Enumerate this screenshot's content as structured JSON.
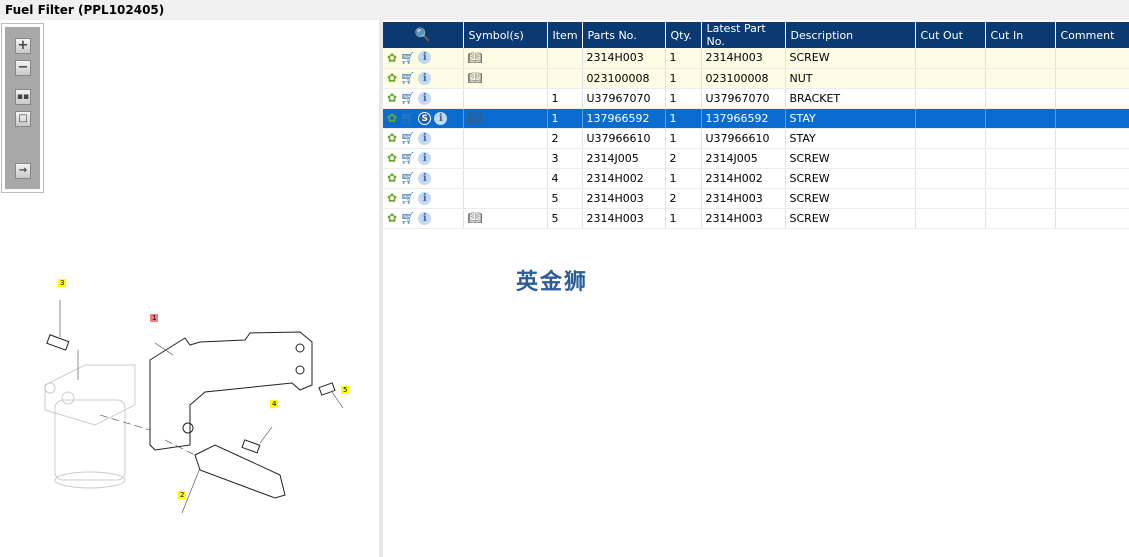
{
  "window": {
    "title": "Fuel Filter (PPL102405)"
  },
  "toolbar": {
    "buttons": [
      "zoom-in",
      "zoom-out",
      "fit-all",
      "actual-size",
      "export"
    ]
  },
  "diagram": {
    "callouts": [
      {
        "label": "1",
        "highlighted": true
      },
      {
        "label": "2"
      },
      {
        "label": "3"
      },
      {
        "label": "4"
      },
      {
        "label": "5"
      }
    ]
  },
  "grid": {
    "columns": [
      "",
      "Symbol(s)",
      "Item",
      "Parts No.",
      "Qty.",
      "Latest Part No.",
      "Description",
      "Cut Out",
      "Cut In",
      "Comment"
    ],
    "rows": [
      {
        "style": "yel",
        "symbol": true,
        "s": false,
        "item": "",
        "part": "2314H003",
        "qty": "1",
        "latest": "2314H003",
        "desc": "SCREW"
      },
      {
        "style": "yel",
        "symbol": true,
        "s": false,
        "item": "",
        "part": "023100008",
        "qty": "1",
        "latest": "023100008",
        "desc": "NUT"
      },
      {
        "style": "",
        "symbol": false,
        "s": false,
        "item": "1",
        "part": "U37967070",
        "qty": "1",
        "latest": "U37967070",
        "desc": "BRACKET"
      },
      {
        "style": "sel",
        "symbol": true,
        "s": true,
        "item": "1",
        "part": "137966592",
        "qty": "1",
        "latest": "137966592",
        "desc": "STAY"
      },
      {
        "style": "",
        "symbol": false,
        "s": false,
        "item": "2",
        "part": "U37966610",
        "qty": "1",
        "latest": "U37966610",
        "desc": "STAY"
      },
      {
        "style": "",
        "symbol": false,
        "s": false,
        "item": "3",
        "part": "2314J005",
        "qty": "2",
        "latest": "2314J005",
        "desc": "SCREW"
      },
      {
        "style": "",
        "symbol": false,
        "s": false,
        "item": "4",
        "part": "2314H002",
        "qty": "1",
        "latest": "2314H002",
        "desc": "SCREW"
      },
      {
        "style": "",
        "symbol": false,
        "s": false,
        "item": "5",
        "part": "2314H003",
        "qty": "2",
        "latest": "2314H003",
        "desc": "SCREW"
      },
      {
        "style": "",
        "symbol": true,
        "s": false,
        "item": "5",
        "part": "2314H003",
        "qty": "1",
        "latest": "2314H003",
        "desc": "SCREW"
      }
    ]
  },
  "watermark": "英金狮"
}
